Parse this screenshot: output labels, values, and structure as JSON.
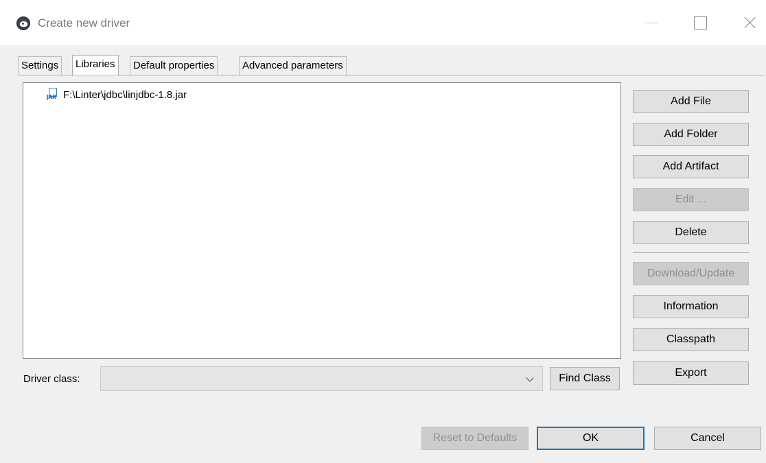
{
  "window": {
    "title": "Create new driver"
  },
  "tabs": [
    {
      "label": "Settings",
      "active": false
    },
    {
      "label": "Libraries",
      "active": true
    },
    {
      "label": "Default properties",
      "active": false
    },
    {
      "label": "Advanced parameters",
      "active": false
    }
  ],
  "libraries": {
    "items": [
      {
        "icon": "jar-file-icon",
        "icon_text": "JAR",
        "path": "F:\\Linter\\jdbc\\linjdbc-1.8.jar"
      }
    ]
  },
  "side_buttons": {
    "add_file": "Add File",
    "add_folder": "Add Folder",
    "add_artifact": "Add Artifact",
    "edit": "Edit ...",
    "delete": "Delete",
    "download_update": "Download/Update",
    "information": "Information",
    "classpath": "Classpath",
    "export": "Export"
  },
  "driver_class": {
    "label": "Driver class:",
    "value": "",
    "find_class": "Find Class"
  },
  "footer": {
    "reset": "Reset to Defaults",
    "ok": "OK",
    "cancel": "Cancel"
  },
  "colors": {
    "accent": "#0078d7",
    "disabled_text": "#8f8f8f",
    "window_bg": "#f0f0f0"
  }
}
